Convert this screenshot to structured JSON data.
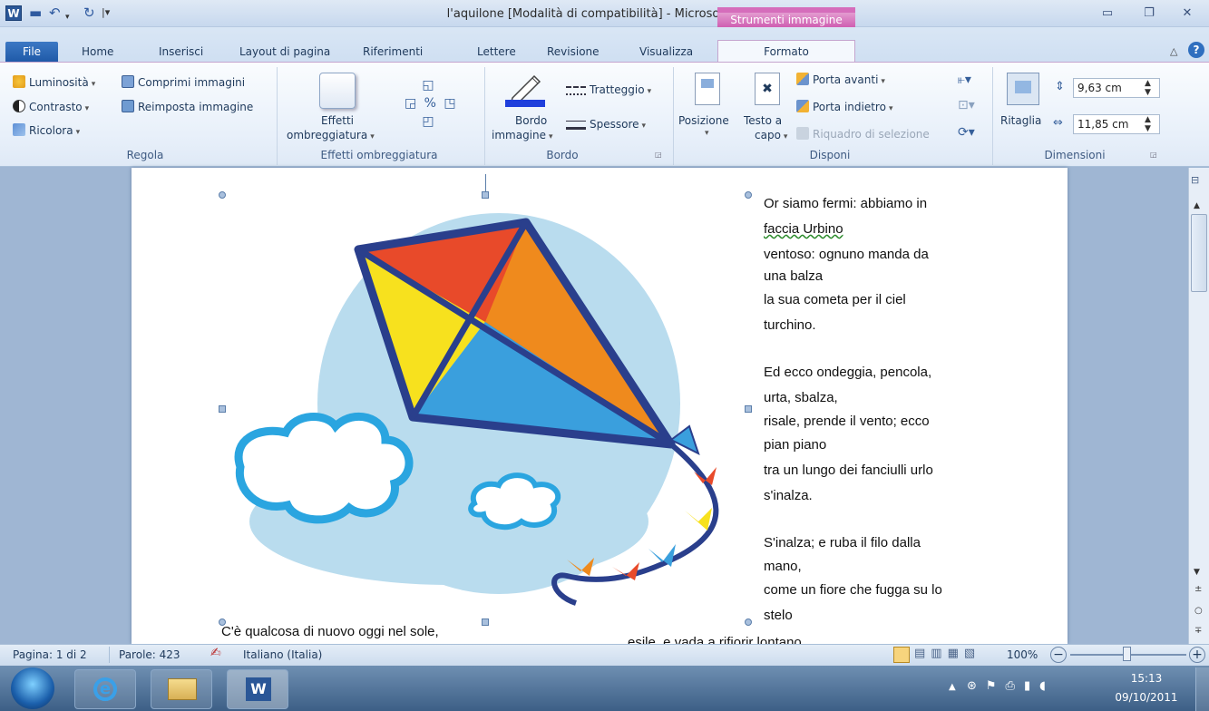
{
  "window": {
    "title": "l'aquilone [Modalità di compatibilità] - Microsoft Word",
    "context_tool": "Strumenti immagine"
  },
  "tabs": {
    "file": "File",
    "home": "Home",
    "inserisci": "Inserisci",
    "layout": "Layout di pagina",
    "riferimenti": "Riferimenti",
    "lettere": "Lettere",
    "revisione": "Revisione",
    "visualizza": "Visualizza",
    "formato": "Formato"
  },
  "ribbon": {
    "regola": {
      "luminosita": "Luminosità",
      "contrasto": "Contrasto",
      "ricolora": "Ricolora",
      "comprimi": "Comprimi immagini",
      "reimposta": "Reimposta immagine",
      "label": "Regola"
    },
    "ombre": {
      "effetti1": "Effetti",
      "effetti2": "ombreggiatura",
      "label": "Effetti ombreggiatura"
    },
    "bordo": {
      "bordo1": "Bordo",
      "bordo2": "immagine",
      "tratteggio": "Tratteggio",
      "spessore": "Spessore",
      "label": "Bordo"
    },
    "disponi": {
      "posizione": "Posizione",
      "testo1": "Testo a",
      "testo2": "capo",
      "porta_avanti": "Porta avanti",
      "porta_indietro": "Porta indietro",
      "riquadro": "Riquadro di selezione",
      "label": "Disponi"
    },
    "dimensioni": {
      "ritaglia": "Ritaglia",
      "altezza": "9,63 cm",
      "larghezza": "11,85 cm",
      "label": "Dimensioni"
    }
  },
  "document": {
    "lines": [
      "Or siamo fermi: abbiamo in",
      "faccia Urbino",
      "ventoso: ognuno manda da",
      "una balza",
      "la sua cometa per il ciel",
      "turchino.",
      "",
      "Ed ecco ondeggia, pencola,",
      "urta, sbalza,",
      "risale, prende il vento; ecco",
      "pian piano",
      "tra un lungo dei fanciulli urlo",
      "s'inalza.",
      "",
      "S'inalza; e ruba il filo dalla",
      "mano,",
      "come un fiore che fugga su lo",
      "stelo"
    ],
    "bottom_left": "C'è qualcosa di nuovo oggi nel sole,",
    "bottom_right": "esile, e vada a rifiorir lontano."
  },
  "status": {
    "page": "Pagina: 1 di 2",
    "words": "Parole: 423",
    "language": "Italiano (Italia)",
    "zoom": "100%"
  },
  "taskbar": {
    "time": "15:13",
    "date": "09/10/2011"
  },
  "colors": {
    "accent": "#2b5797",
    "context": "#cf5fb1"
  }
}
